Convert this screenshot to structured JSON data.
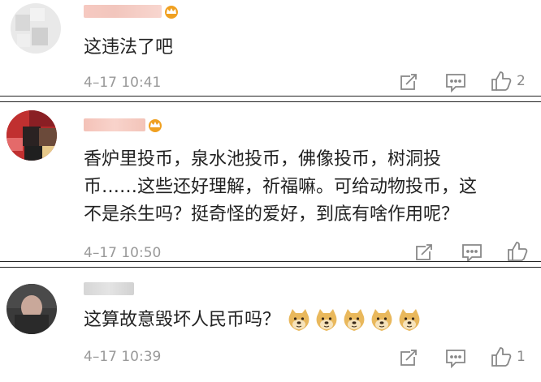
{
  "comments": [
    {
      "text": "这违法了吧",
      "time": "4–17 10:41",
      "likes": "2",
      "icons": [
        "share-icon",
        "comment-icon",
        "like-icon"
      ]
    },
    {
      "text_lines": [
        "香炉里投币，泉水池投币，佛像投币，树洞投",
        "币……这些还好理解，祈福嘛。可给动物投币，这",
        "不是杀生吗？挺奇怪的爱好，到底有啥作用呢？"
      ],
      "time": "4–17 10:50",
      "likes": "",
      "icons": [
        "share-icon",
        "comment-icon",
        "like-icon"
      ]
    },
    {
      "text": "这算故意毁坏人民币吗？",
      "emoji_count": 5,
      "emoji": "doge-emoji",
      "time": "4–17 10:39",
      "likes": "1",
      "icons": [
        "share-icon",
        "comment-icon",
        "like-icon"
      ]
    }
  ],
  "colors": {
    "text": "#222222",
    "meta": "#999999",
    "icon": "#888888",
    "crown": "#f0a020"
  }
}
